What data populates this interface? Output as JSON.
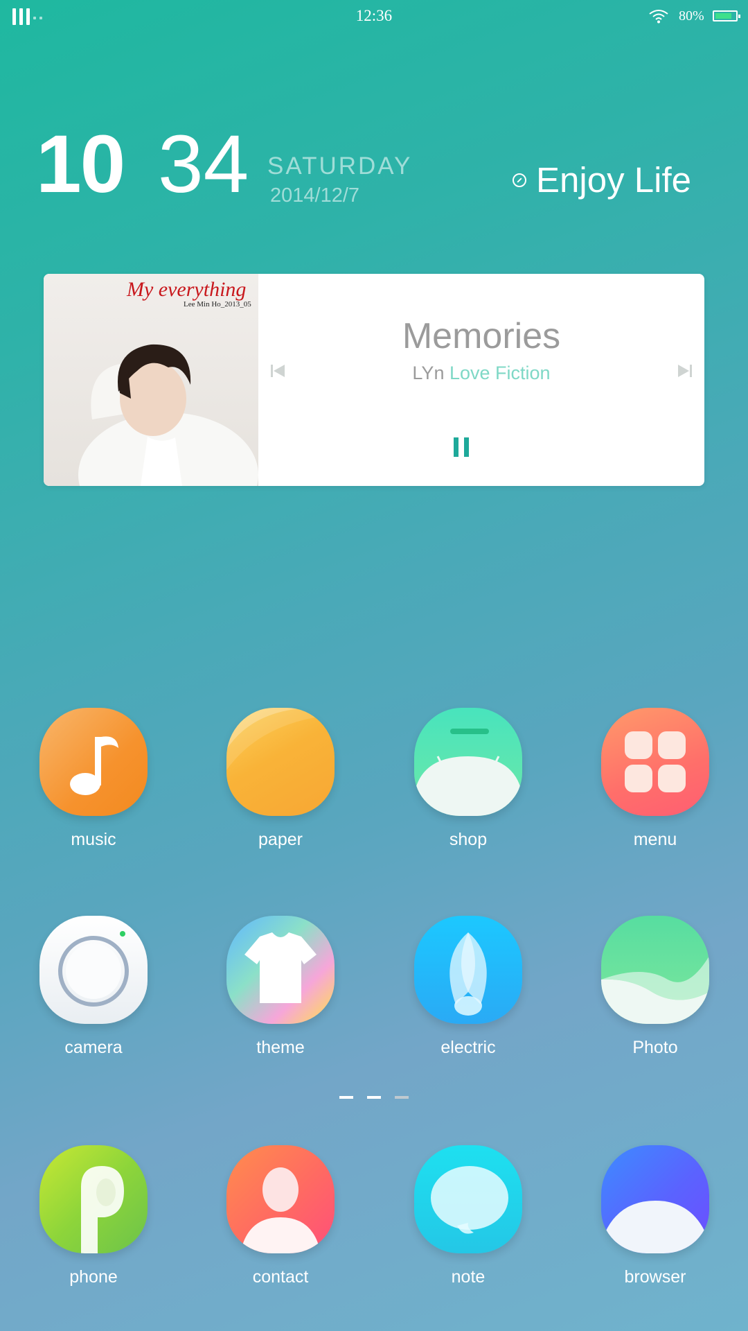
{
  "status_bar": {
    "time": "12:36",
    "battery_percent": "80%",
    "battery_level": 0.8,
    "icons": [
      "signal-icon",
      "wifi-icon",
      "battery-icon"
    ]
  },
  "clock_widget": {
    "hour": "10",
    "minute": "34",
    "day": "SATURDAY",
    "date": "2014/12/7",
    "tagline": "Enjoy Life"
  },
  "music_widget": {
    "album_cover_title": "My everything",
    "album_cover_subtitle": "Lee Min Ho_2013_05",
    "song_title": "Memories",
    "artist": "LYn",
    "album": "Love Fiction",
    "state": "playing",
    "accent_color": "#1ea99a"
  },
  "apps": [
    {
      "label": "music"
    },
    {
      "label": "paper"
    },
    {
      "label": "shop"
    },
    {
      "label": "menu"
    },
    {
      "label": "camera"
    },
    {
      "label": "theme"
    },
    {
      "label": "electric"
    },
    {
      "label": "Photo"
    }
  ],
  "page_indicator": {
    "pages": 3,
    "current": 1
  },
  "dock": [
    {
      "label": "phone"
    },
    {
      "label": "contact"
    },
    {
      "label": "note"
    },
    {
      "label": "browser"
    }
  ]
}
